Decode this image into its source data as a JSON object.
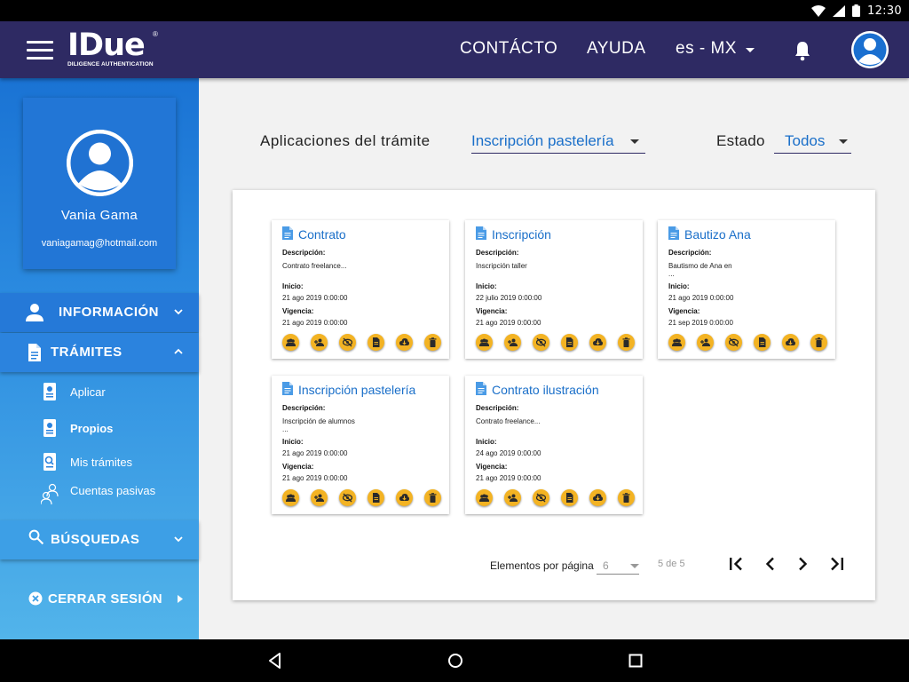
{
  "status_bar": {
    "time": "12:30"
  },
  "header": {
    "logo_text": "IDue",
    "logo_reg": "®",
    "logo_subtitle": "DILIGENCE AUTHENTICATION",
    "nav": {
      "contact": "CONTÁCTO",
      "help": "AYUDA",
      "language": "es - MX"
    },
    "colors": {
      "header_bg": "#2e2a63"
    }
  },
  "sidebar": {
    "profile": {
      "name": "Vania Gama",
      "email": "vaniagamag@hotmail.com"
    },
    "sections": {
      "info": "INFORMACIÓN",
      "tramites": "TRÁMITES",
      "busquedas": "BÚSQUEDAS"
    },
    "tramites_items": {
      "aplicar": "Aplicar",
      "propios": "Propios",
      "mis_tramites": "Mis trámites",
      "cuentas_pasivas": "Cuentas pasivas"
    },
    "logout": "CERRAR SESIÓN",
    "colors": {
      "top": "#1a73d4",
      "bottom": "#52b4ea"
    }
  },
  "filters": {
    "app_label": "Aplicaciones del trámite",
    "app_value": "Inscripción pastelería",
    "estado_label": "Estado",
    "estado_value": "Todos"
  },
  "card_labels": {
    "description": "Descripción:",
    "start": "Inicio:",
    "validity": "Vigencia:"
  },
  "cards": [
    {
      "title": "Contrato",
      "description": "Contrato freelance...",
      "description_extra": "",
      "start": "21 ago 2019 0:00:00",
      "validity": "21 ago 2019 0:00:00"
    },
    {
      "title": "Inscripción",
      "description": "Inscripción taller",
      "description_extra": "",
      "start": "22 julio 2019 0:00:00",
      "validity": "21 ago 2019 0:00:00"
    },
    {
      "title": "Bautizo Ana",
      "description": "Bautismo de Ana en",
      "description_extra": "...",
      "start": "21 ago 2019 0:00:00",
      "validity": "21 sep 2019 0:00:00"
    },
    {
      "title": "Inscripción pastelería",
      "description": "Inscripción de alumnos",
      "description_extra": "...",
      "start": "21 ago 2019 0:00:00",
      "validity": "21 ago 2019 0:00:00"
    },
    {
      "title": "Contrato ilustración",
      "description": "Contrato freelance...",
      "description_extra": "",
      "start": "24 ago 2019 0:00:00",
      "validity": "21 ago 2019 0:00:00"
    }
  ],
  "card_actions": [
    "group-icon",
    "add-group-icon",
    "hide-icon",
    "document-icon",
    "cloud-download-icon",
    "delete-icon"
  ],
  "pagination": {
    "per_page_label": "Elementos por página",
    "per_page_value": "6",
    "range": "5 de 5"
  },
  "accent_colors": {
    "action_button": "#f3b323",
    "link_blue": "#1a6fc9"
  }
}
